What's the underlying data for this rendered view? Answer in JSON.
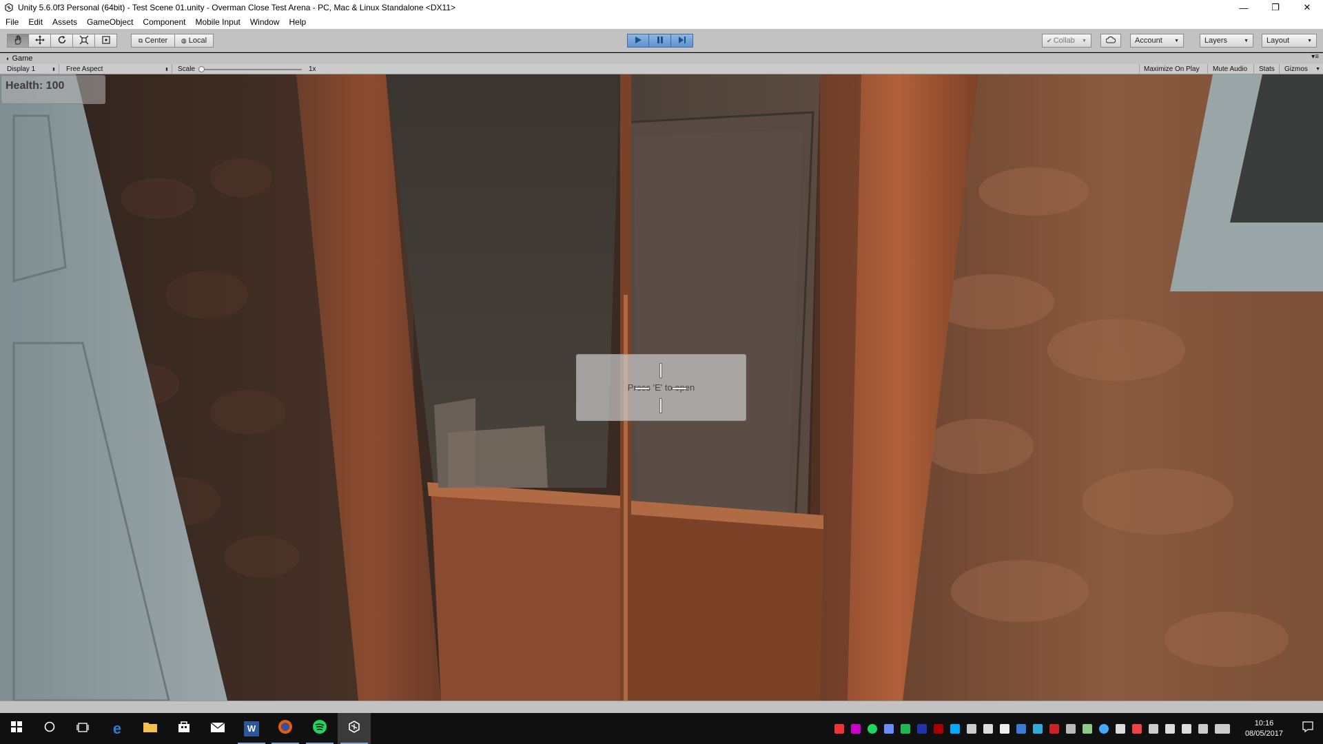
{
  "window": {
    "title": "Unity 5.6.0f3 Personal (64bit) - Test Scene 01.unity - Overman Close Test Arena - PC, Mac & Linux Standalone <DX11>",
    "controls": [
      "—",
      "❐",
      "✕"
    ]
  },
  "menu": [
    "File",
    "Edit",
    "Assets",
    "GameObject",
    "Component",
    "Mobile Input",
    "Window",
    "Help"
  ],
  "toolbar": {
    "pivot_label": "Center",
    "space_label": "Local",
    "collab_label": "Collab",
    "account_label": "Account",
    "layers_label": "Layers",
    "layout_label": "Layout",
    "play_state": "playing"
  },
  "game_tab": {
    "label": "Game",
    "display": "Display 1",
    "aspect": "Free Aspect",
    "scale_label": "Scale",
    "scale_value": "1x",
    "maximize_on_play": "Maximize On Play",
    "mute_audio": "Mute Audio",
    "stats": "Stats",
    "gizmos": "Gizmos"
  },
  "hud": {
    "health_text": "Health: 100",
    "prompt_text": "Press 'E' to open"
  },
  "taskbar": {
    "clock_time": "10:16",
    "clock_date": "08/05/2017"
  }
}
